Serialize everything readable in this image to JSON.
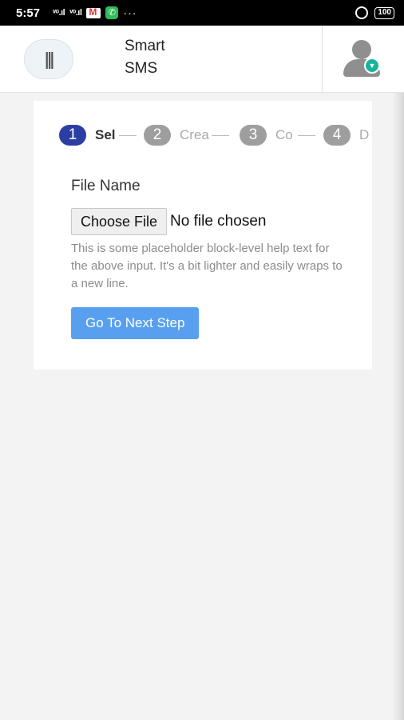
{
  "status_bar": {
    "time": "5:57",
    "signal1": "ᵛᵒ.ıl",
    "signal2": "ᵛᵒ.ıl",
    "dots": "···",
    "battery": "100"
  },
  "header": {
    "brand_line1": "Smart",
    "brand_line2": "SMS"
  },
  "steps": [
    {
      "num": "1",
      "label": "Sel",
      "active": true
    },
    {
      "num": "2",
      "label": "Crea",
      "active": false
    },
    {
      "num": "3",
      "label": "Co",
      "active": false
    },
    {
      "num": "4",
      "label": "D",
      "active": false
    }
  ],
  "form": {
    "file_label": "File Name",
    "choose_button": "Choose File",
    "file_status": "No file chosen",
    "help_text": "This is some placeholder block-level help text for the above input. It's a bit lighter and easily wraps to a new line.",
    "next_button": "Go To Next Step"
  },
  "colors": {
    "active_step": "#2c3ea3",
    "inactive_step": "#9e9e9e",
    "primary_button": "#58a0ef",
    "badge": "#19b39b"
  }
}
